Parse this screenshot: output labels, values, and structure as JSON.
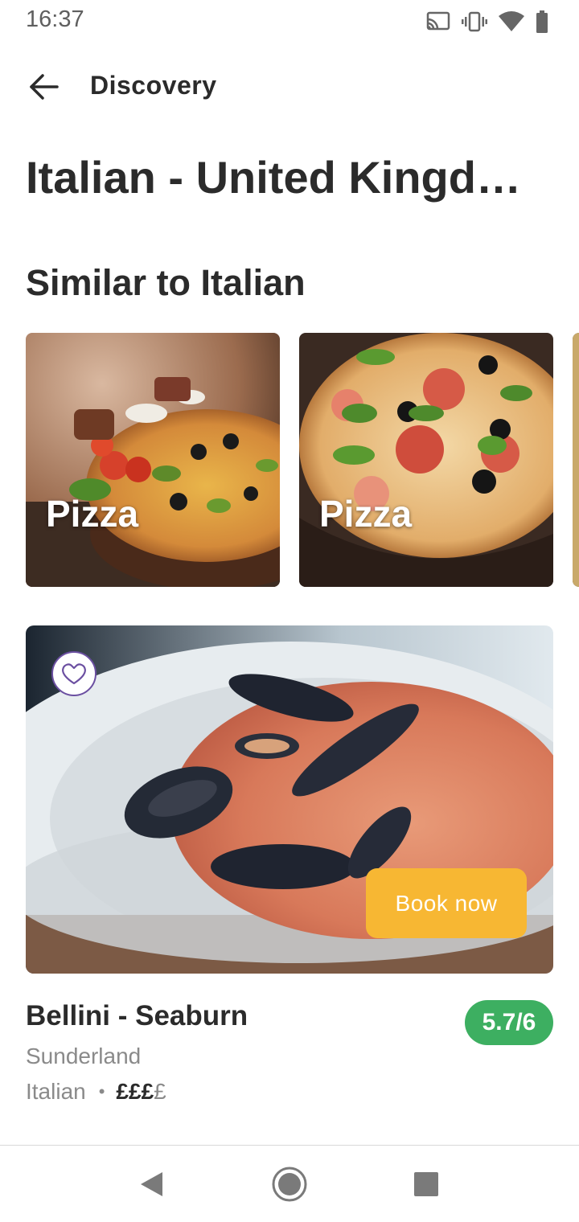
{
  "status_bar": {
    "time": "16:37",
    "icons": [
      "cast-icon",
      "vibrate-icon",
      "wifi-icon",
      "battery-icon"
    ]
  },
  "app_bar": {
    "back_icon": "arrow-left-icon",
    "title": "Discovery"
  },
  "page": {
    "title": "Italian - United Kingd…",
    "section_title": "Similar to Italian"
  },
  "categories": [
    {
      "label": "Pizza",
      "image": "pizza-photo"
    },
    {
      "label": "Pizza",
      "image": "pizza-photo"
    },
    {
      "label": "",
      "image": "partial-card"
    }
  ],
  "restaurant": {
    "image": "mussels-risotto-photo",
    "favorite_icon": "heart-outline-icon",
    "book_label": "Book now",
    "name": "Bellini - Seaburn",
    "rating": "5.7/6",
    "city": "Sunderland",
    "cuisine": "Italian",
    "separator": "•",
    "price_active": "£££",
    "price_inactive": "£"
  },
  "nav_bar": {
    "items": [
      "back-triangle-icon",
      "home-circle-icon",
      "recents-square-icon"
    ]
  },
  "colors": {
    "book_button": "#f7b733",
    "rating_badge": "#3daf61",
    "favorite_border": "#6b4fa1"
  }
}
